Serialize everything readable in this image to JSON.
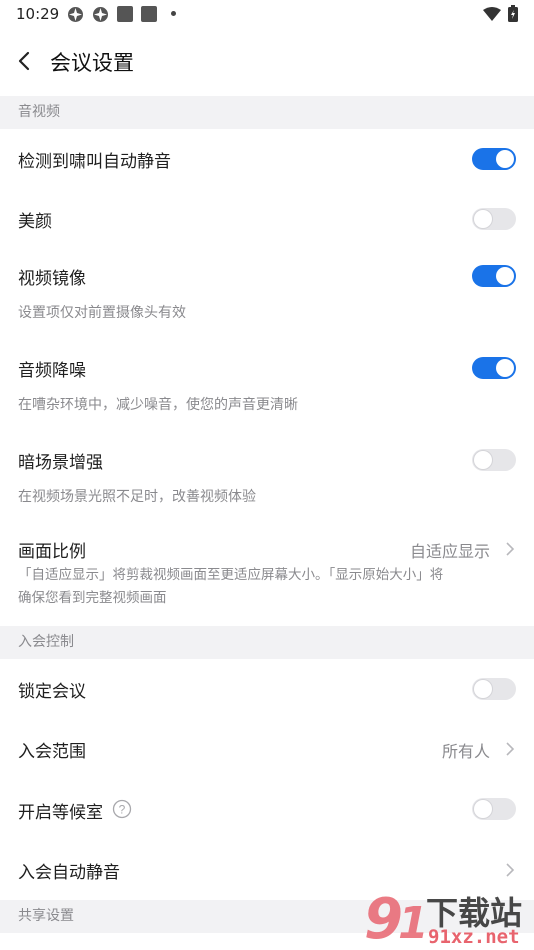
{
  "status_bar": {
    "time": "10:29"
  },
  "header": {
    "title": "会议设置"
  },
  "sections": {
    "audio_video": "音视频",
    "join_control": "入会控制",
    "share": "共享设置"
  },
  "rows": {
    "howl_mute": {
      "label": "检测到啸叫自动静音",
      "on": true
    },
    "beauty": {
      "label": "美颜",
      "on": false
    },
    "mirror": {
      "label": "视频镜像",
      "desc": "设置项仅对前置摄像头有效",
      "on": true
    },
    "noise": {
      "label": "音频降噪",
      "desc": "在嘈杂环境中，减少噪音，使您的声音更清晰",
      "on": true
    },
    "low_light": {
      "label": "暗场景增强",
      "desc": "在视频场景光照不足时，改善视频体验",
      "on": false
    },
    "aspect": {
      "label": "画面比例",
      "value": "自适应显示",
      "desc_line1": "「自适应显示」将剪裁视频画面至更适应屏幕大小。「显示原始大小」将",
      "desc_line2": "确保您看到完整视频画面"
    },
    "lock": {
      "label": "锁定会议",
      "on": false
    },
    "join_scope": {
      "label": "入会范围",
      "value": "所有人"
    },
    "waiting_room": {
      "label": "开启等候室",
      "on": false
    },
    "auto_mute": {
      "label": "入会自动静音"
    }
  },
  "watermark": {
    "brand": "下载站",
    "domain": "91xz.net"
  }
}
